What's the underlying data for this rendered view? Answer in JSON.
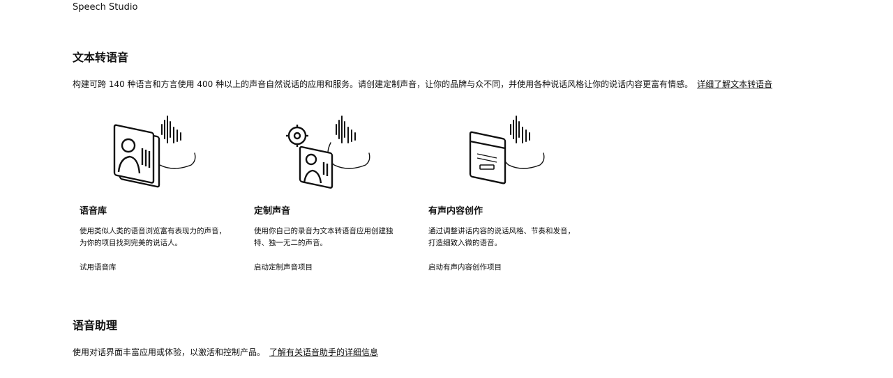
{
  "app": {
    "title": "Speech Studio"
  },
  "tts": {
    "title": "文本转语音",
    "description": "构建可跨 140 种语言和方言使用 400 种以上的声音自然说话的应用和服务。请创建定制声音，让你的品牌与众不同，并使用各种说话风格让你的说话内容更富有情感。",
    "learn_more": "详细了解文本转语音",
    "cards": [
      {
        "icon": "voice-gallery-icon",
        "title": "语音库",
        "description": "使用类似人类的语音浏览富有表现力的声音，为你的项目找到完美的说话人。",
        "link": "试用语音库"
      },
      {
        "icon": "custom-voice-icon",
        "title": "定制声音",
        "description": "使用你自己的录音为文本转语音应用创建独特、独一无二的声音。",
        "link": "启动定制声音项目"
      },
      {
        "icon": "audio-content-creation-icon",
        "title": "有声内容创作",
        "description": "通过调整讲话内容的说话风格、节奏和发音，打造细致入微的语音。",
        "link": "启动有声内容创作项目"
      }
    ]
  },
  "voice_assistant": {
    "title": "语音助理",
    "description": "使用对话界面丰富应用或体验，以激活和控制产品。",
    "learn_more": "了解有关语音助手的详细信息"
  }
}
